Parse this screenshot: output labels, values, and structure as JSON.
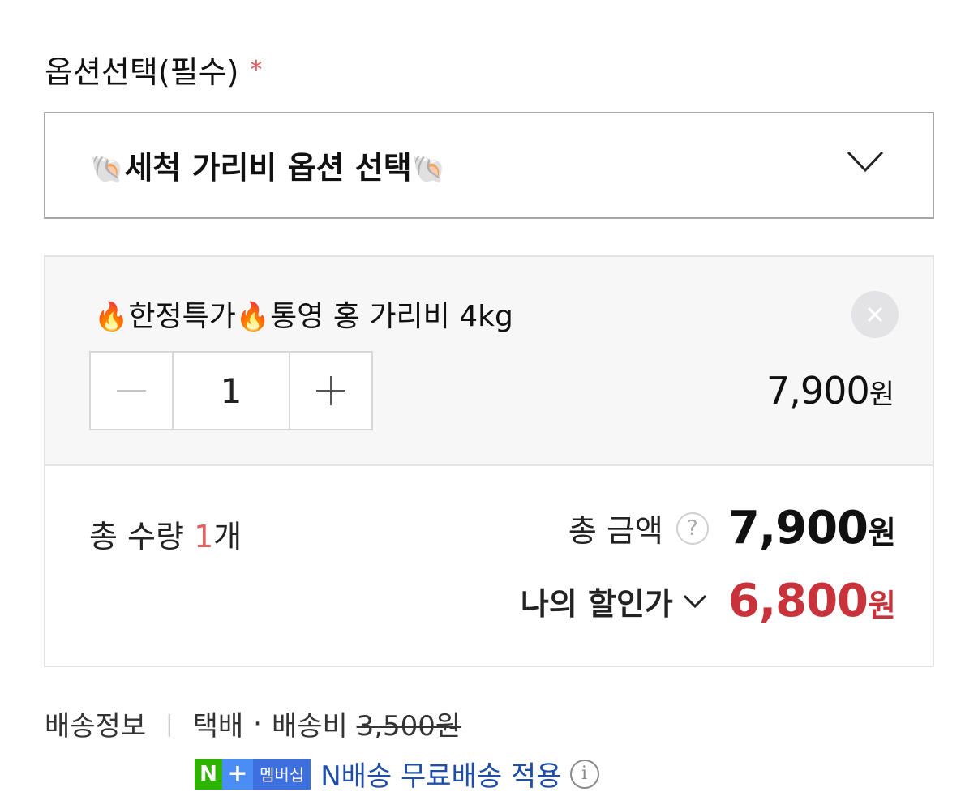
{
  "option_section": {
    "title": "옵션선택(필수)",
    "required_mark": "*",
    "select_icon": "spiral-shell-icon",
    "select_label": "세척 가리비 옵션 선택"
  },
  "selected_item": {
    "fire_icon": "fire-icon",
    "name_part1": "한정특가",
    "name_part2": "통영 홍 가리비 4kg",
    "quantity": "1",
    "price": "7,900",
    "currency": "원"
  },
  "totals": {
    "qty_label": "총 수량",
    "qty_value": "1",
    "qty_unit": "개",
    "amount_label": "총 금액",
    "help_mark": "?",
    "amount_value": "7,900",
    "currency": "원",
    "discount_label": "나의 할인가",
    "discount_value": "6,800"
  },
  "shipping": {
    "label": "배송정보",
    "method": "택배",
    "dot": "·",
    "fee_label": "배송비",
    "fee_value": "3,500원",
    "badge_n": "N",
    "badge_plus": "+",
    "badge_member": "멤버십",
    "free_text": "N배송 무료배송 적용",
    "info_mark": "i"
  },
  "colors": {
    "accent_red": "#c8323a",
    "qty_red": "#e06464",
    "naver_green": "#2db400",
    "member_blue": "#1f4ea8"
  }
}
